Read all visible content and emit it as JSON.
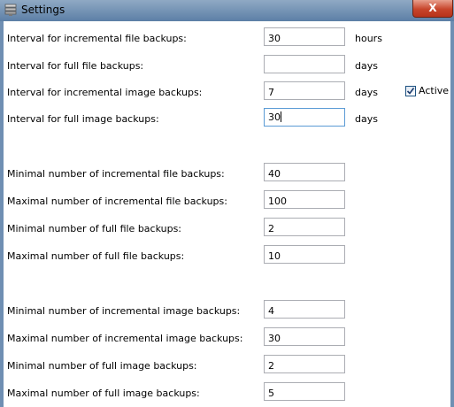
{
  "window": {
    "title": "Settings",
    "close_label": "X",
    "app_icon": "app-icon"
  },
  "intervals": [
    {
      "label": "Interval for incremental file backups:",
      "value": "30",
      "unit": "hours"
    },
    {
      "label": "Interval for full file backups:",
      "value": "",
      "unit": "days"
    },
    {
      "label": "Interval for incremental image backups:",
      "value": "7",
      "unit": "days"
    },
    {
      "label": "Interval for full image backups:",
      "value": "30",
      "unit": "days"
    }
  ],
  "active_checkbox": {
    "label": "Active",
    "checked": true
  },
  "file_counts": [
    {
      "label": "Minimal number of incremental file backups:",
      "value": "40"
    },
    {
      "label": "Maximal number of incremental file backups:",
      "value": "100"
    },
    {
      "label": "Minimal number of full file backups:",
      "value": "2"
    },
    {
      "label": "Maximal number of full file backups:",
      "value": "10"
    }
  ],
  "image_counts": [
    {
      "label": "Minimal number of incremental image backups:",
      "value": "4"
    },
    {
      "label": "Maximal number of incremental image backups:",
      "value": "30"
    },
    {
      "label": "Minimal number of full image backups:",
      "value": "2"
    },
    {
      "label": "Maximal number of full image backups:",
      "value": "5"
    }
  ]
}
